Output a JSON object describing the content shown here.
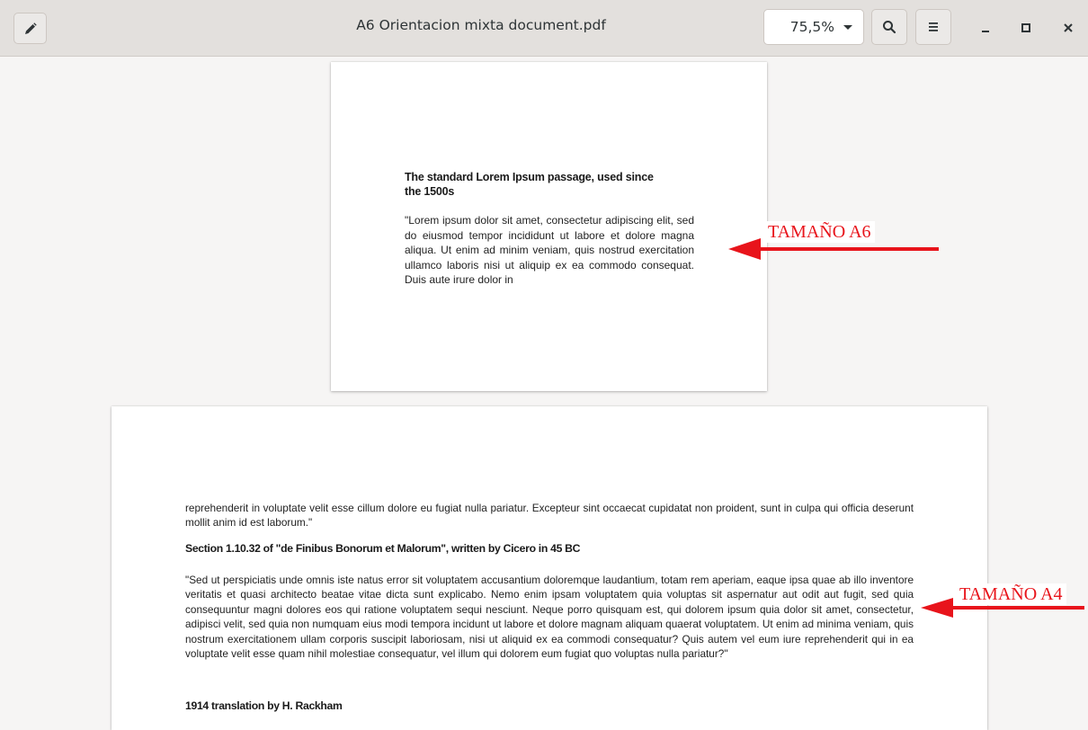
{
  "header": {
    "title": "A6 Orientacion mixta document.pdf",
    "zoom": "75,5%",
    "icons": {
      "edit": "pencil-icon",
      "search": "search-icon",
      "menu": "hamburger-menu-icon",
      "minimize": "minimize-icon",
      "maximize": "maximize-icon",
      "close": "close-icon"
    }
  },
  "pages": {
    "a6": {
      "heading": "The standard Lorem Ipsum passage, used since the 1500s",
      "paragraph": "\"Lorem ipsum dolor sit amet, consectetur adipiscing elit, sed do eiusmod tempor incididunt ut labore et dolore magna aliqua. Ut enim ad minim veniam, quis nostrud exercitation ullamco laboris nisi ut aliquip ex ea commodo consequat. Duis aute irure dolor in"
    },
    "a4": {
      "paragraph1": "reprehenderit in voluptate velit esse cillum dolore eu fugiat nulla pariatur. Excepteur sint occaecat cupidatat non proident, sunt in culpa qui officia deserunt mollit anim id est laborum.\"",
      "heading1": "Section 1.10.32 of \"de Finibus Bonorum et Malorum\", written by Cicero in 45 BC",
      "paragraph2": "\"Sed ut perspiciatis unde omnis iste natus error sit voluptatem accusantium doloremque laudantium, totam rem aperiam, eaque ipsa quae ab illo inventore veritatis et quasi architecto beatae vitae dicta sunt explicabo. Nemo enim ipsam voluptatem quia voluptas sit aspernatur aut odit aut fugit, sed quia consequuntur magni dolores eos qui ratione voluptatem sequi nesciunt. Neque porro quisquam est, qui dolorem ipsum quia dolor sit amet, consectetur, adipisci velit, sed quia non numquam eius modi tempora incidunt ut labore et dolore magnam aliquam quaerat voluptatem. Ut enim ad minima veniam, quis nostrum exercitationem ullam corporis suscipit laboriosam, nisi ut aliquid ex ea commodi consequatur? Quis autem vel eum iure reprehenderit qui in ea voluptate velit esse quam nihil molestiae consequatur, vel illum qui dolorem eum fugiat quo voluptas nulla pariatur?\"",
      "heading2": "1914 translation by H. Rackham"
    }
  },
  "annotations": {
    "a6_label": "TAMAÑO A6",
    "a4_label": "TAMAÑO A4",
    "color": "#e8141b"
  },
  "colors": {
    "headerbar": "#e3e0dd",
    "background": "#f6f5f4"
  }
}
